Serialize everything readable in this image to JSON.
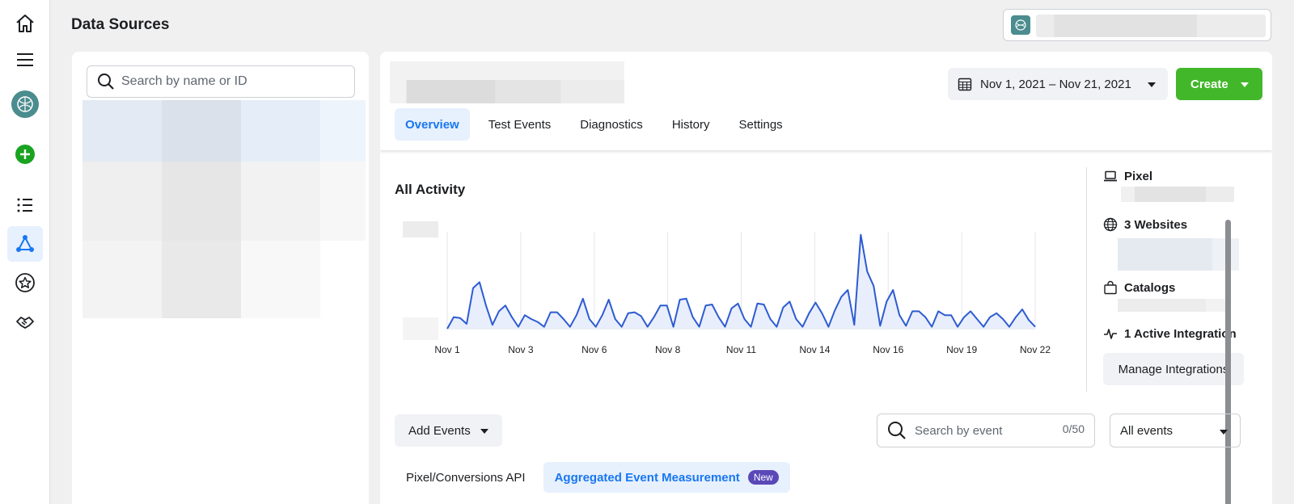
{
  "page": {
    "title": "Data Sources"
  },
  "search": {
    "placeholder": "Search by name or ID"
  },
  "header": {
    "date_range": "Nov 1, 2021 – Nov 21, 2021",
    "create_label": "Create"
  },
  "tabs": [
    {
      "label": "Overview",
      "active": true
    },
    {
      "label": "Test Events"
    },
    {
      "label": "Diagnostics"
    },
    {
      "label": "History"
    },
    {
      "label": "Settings"
    }
  ],
  "activity": {
    "title": "All Activity"
  },
  "chart_data": {
    "type": "area",
    "title": "All Activity",
    "xlabel": "",
    "ylabel": "",
    "x_ticks": [
      "Nov 1",
      "Nov 3",
      "Nov 6",
      "Nov 8",
      "Nov 11",
      "Nov 14",
      "Nov 16",
      "Nov 19",
      "Nov 22"
    ],
    "values": [
      0,
      12,
      11,
      5,
      42,
      48,
      24,
      4,
      18,
      24,
      12,
      2,
      14,
      10,
      7,
      2,
      17,
      17,
      10,
      2,
      14,
      31,
      10,
      2,
      14,
      30,
      10,
      2,
      16,
      17,
      13,
      2,
      12,
      24,
      24,
      2,
      30,
      31,
      12,
      2,
      24,
      25,
      12,
      2,
      21,
      26,
      10,
      2,
      26,
      25,
      10,
      2,
      22,
      28,
      10,
      2,
      16,
      27,
      16,
      2,
      19,
      33,
      40,
      4,
      97,
      59,
      44,
      3,
      28,
      40,
      14,
      3,
      18,
      18,
      12,
      2,
      18,
      14,
      14,
      2,
      12,
      18,
      10,
      2,
      12,
      16,
      10,
      2,
      12,
      20,
      9,
      2
    ],
    "ylim": [
      0,
      100
    ],
    "grid": true,
    "color": "#2d5bd2"
  },
  "side": {
    "pixel_label": "Pixel",
    "websites_label": "3 Websites",
    "catalogs_label": "Catalogs",
    "integration_label": "1 Active Integration",
    "manage_label": "Manage Integrations"
  },
  "events": {
    "add_label": "Add Events",
    "search_placeholder": "Search by event",
    "count": "0/50",
    "filter_label": "All events"
  },
  "sub_tabs": [
    {
      "label": "Pixel/Conversions API"
    },
    {
      "label": "Aggregated Event Measurement",
      "badge": "New",
      "active": true
    }
  ],
  "colors": {
    "accent": "#1877f2",
    "create": "#42b72a",
    "badge": "#5a48b8"
  }
}
